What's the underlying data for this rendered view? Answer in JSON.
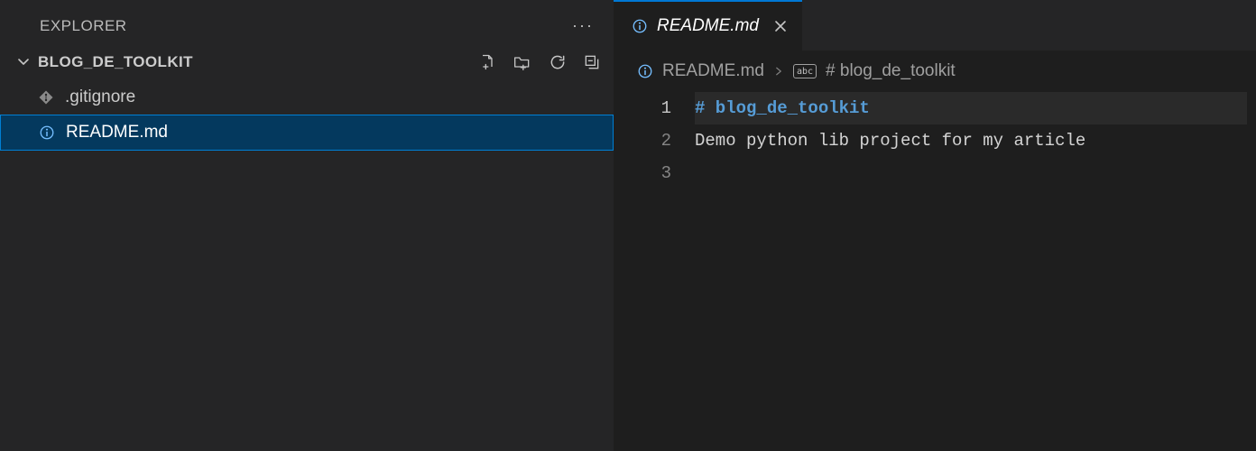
{
  "sidebar": {
    "title": "EXPLORER",
    "folder": "BLOG_DE_TOOLKIT",
    "files": [
      {
        "name": ".gitignore"
      },
      {
        "name": "README.md"
      }
    ]
  },
  "tab": {
    "title": "README.md"
  },
  "breadcrumbs": {
    "file": "README.md",
    "symbol": "# blog_de_toolkit"
  },
  "editor": {
    "lines": [
      {
        "num": "1",
        "text": "# blog_de_toolkit",
        "class": "md-heading"
      },
      {
        "num": "2",
        "text": "Demo python lib project for my article",
        "class": "plain"
      },
      {
        "num": "3",
        "text": "",
        "class": "plain"
      }
    ]
  },
  "colors": {
    "selection": "#04395e",
    "focusBorder": "#007fd4",
    "tabActiveBorder": "#0078d4",
    "mdHeading": "#569cd6"
  }
}
